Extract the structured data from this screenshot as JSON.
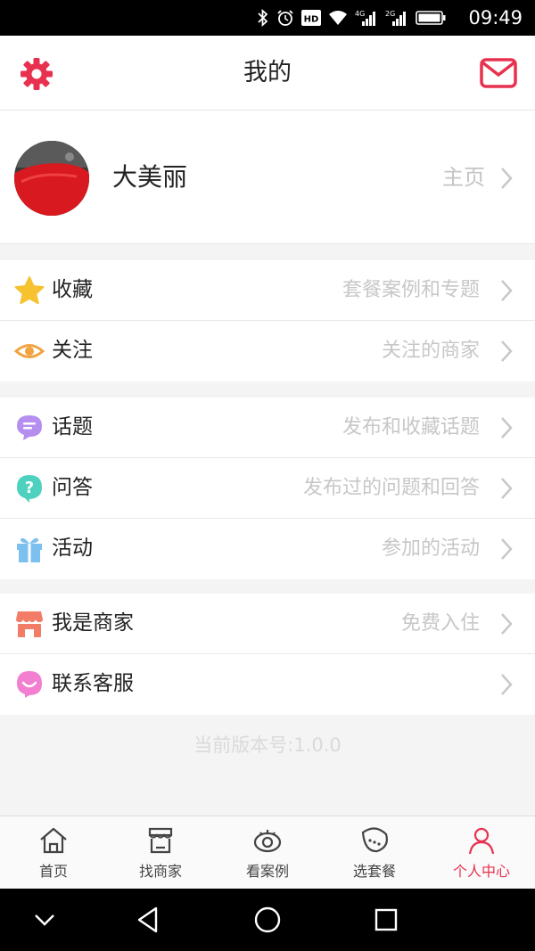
{
  "status_bar": {
    "time": "09:49",
    "icons": [
      "bluetooth-icon",
      "alarm-icon",
      "hd-icon",
      "wifi-icon",
      "signal-4g-icon",
      "signal-2g-icon",
      "battery-icon"
    ],
    "hd_text": "HD",
    "net_4g": "4G",
    "net_2g": "2G"
  },
  "header": {
    "title": "我的",
    "left_icon": "settings-gear-icon",
    "right_icon": "mail-icon",
    "accent_color": "#e8314f"
  },
  "profile": {
    "name": "大美丽",
    "link_label": "主页"
  },
  "groups": [
    {
      "items": [
        {
          "label": "收藏",
          "hint": "套餐案例和专题",
          "icon": "star-icon",
          "color": "#f6c230"
        },
        {
          "label": "关注",
          "hint": "关注的商家",
          "icon": "eye-icon",
          "color": "#f2a341"
        }
      ]
    },
    {
      "items": [
        {
          "label": "话题",
          "hint": "发布和收藏话题",
          "icon": "chat-bubble-icon",
          "color": "#b68ef0"
        },
        {
          "label": "问答",
          "hint": "发布过的问题和回答",
          "icon": "question-icon",
          "color": "#4fd1c0"
        },
        {
          "label": "活动",
          "hint": "参加的活动",
          "icon": "gift-icon",
          "color": "#7cc0f0"
        }
      ]
    },
    {
      "items": [
        {
          "label": "我是商家",
          "hint": "免费入住",
          "icon": "store-icon",
          "color": "#f27c67"
        },
        {
          "label": "联系客服",
          "hint": "",
          "icon": "smile-icon",
          "color": "#f27fd0"
        }
      ]
    }
  ],
  "version_text": "当前版本号:1.0.0",
  "tabs": [
    {
      "label": "首页",
      "icon": "home-icon",
      "active": false
    },
    {
      "label": "找商家",
      "icon": "shop-icon",
      "active": false
    },
    {
      "label": "看案例",
      "icon": "eye-case-icon",
      "active": false
    },
    {
      "label": "选套餐",
      "icon": "leaf-icon",
      "active": false
    },
    {
      "label": "个人中心",
      "icon": "person-icon",
      "active": true
    }
  ],
  "system_nav": [
    "back-down-icon",
    "back-triangle-icon",
    "home-circle-icon",
    "recent-square-icon"
  ]
}
